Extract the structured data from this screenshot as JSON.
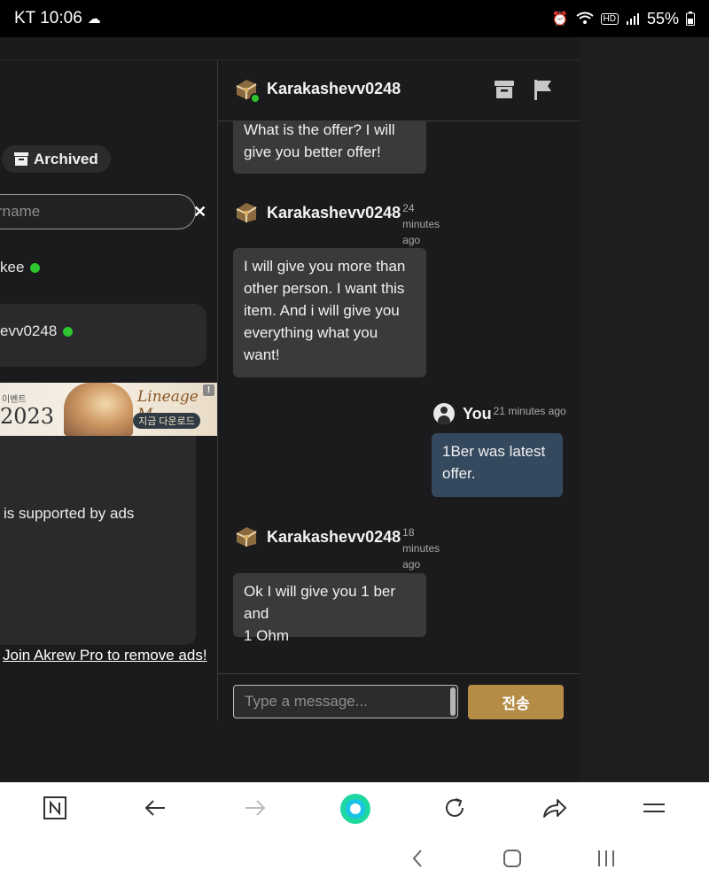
{
  "status_bar": {
    "carrier_time": "KT 10:06",
    "battery": "55%",
    "icons": [
      "cloud-icon",
      "alarm-icon",
      "wifi-icon",
      "hd-icon",
      "signal-icon",
      "battery-icon"
    ]
  },
  "sidebar": {
    "archived_label": "Archived",
    "search_placeholder": "rname",
    "contacts": [
      {
        "name": "kee",
        "online": true
      },
      {
        "name": "evv0248",
        "online": true
      }
    ],
    "ad": {
      "small_text": "이벤트",
      "year": "2023",
      "logo_text": "Lineage M",
      "cta": "지금 다운로드",
      "info": "!"
    },
    "ad_notice": "is supported by ads",
    "join_link": "Join Akrew Pro to remove ads!"
  },
  "chat": {
    "header_name": "Karakashevv0248",
    "messages": [
      {
        "sender": "Karakashevv0248",
        "time": "",
        "text_lines": [
          "What is the offer? I will",
          "give you better offer!"
        ]
      },
      {
        "sender": "Karakashevv0248",
        "time_lines": [
          "24",
          "minutes",
          "ago"
        ],
        "text_lines": [
          "I will give you more than",
          "other person. I want this",
          "item. And i will give you",
          "everything what you",
          "want!"
        ]
      },
      {
        "sender": "You",
        "time": "21 minutes ago",
        "text_lines": [
          "1Ber was latest",
          "offer."
        ]
      },
      {
        "sender": "Karakashevv0248",
        "time_lines": [
          "18",
          "minutes",
          "ago"
        ],
        "text_lines": [
          "Ok I will give you 1 ber and",
          "1 Ohm"
        ]
      }
    ],
    "input_placeholder": "Type a message...",
    "send_label": "전송"
  },
  "browser_toolbar": {
    "items": [
      "n-app-icon",
      "back-arrow-icon",
      "forward-arrow-icon",
      "home-ring-icon",
      "reload-icon",
      "share-icon",
      "menu-icon"
    ]
  },
  "system_nav": {
    "items": [
      "nav-back-icon",
      "nav-home-icon",
      "nav-recents-icon"
    ]
  },
  "colors": {
    "background": "#1b1b1d",
    "bubble_other": "#3a3a3c",
    "bubble_mine": "#34495e",
    "send_button": "#b48c46",
    "online": "#2ec52e"
  }
}
